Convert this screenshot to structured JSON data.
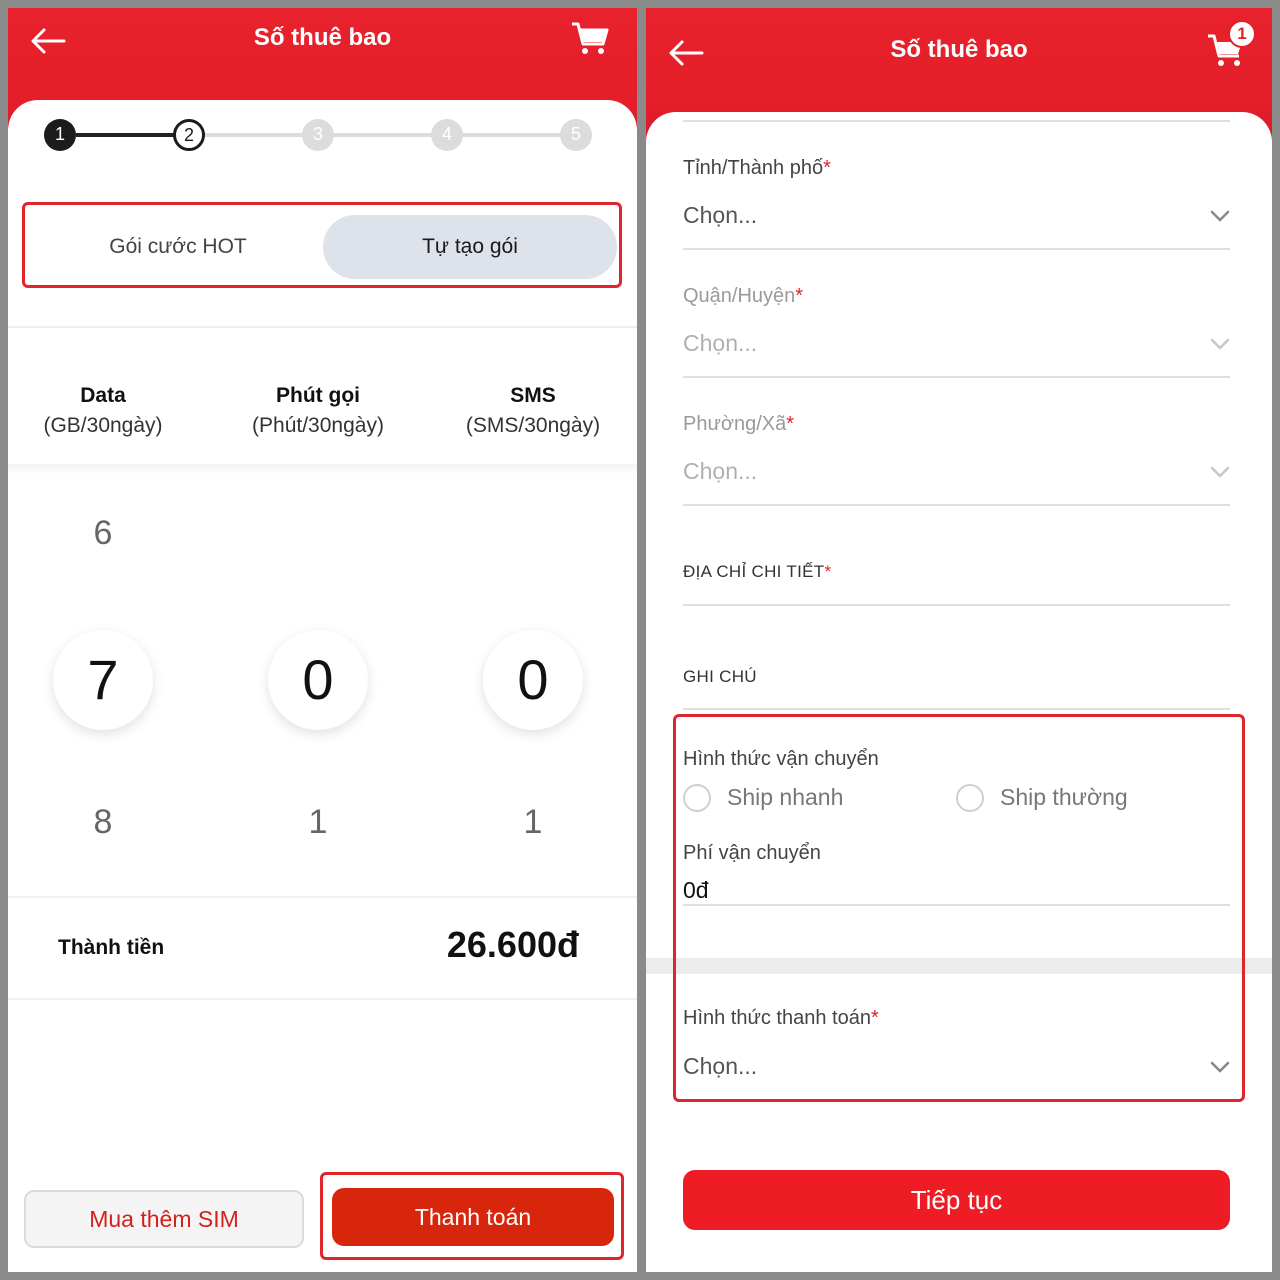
{
  "left": {
    "header": {
      "title": "Số thuê bao"
    },
    "stepper": {
      "steps": [
        "1",
        "2",
        "3",
        "4",
        "5"
      ]
    },
    "tabs": {
      "hot": "Gói cước HOT",
      "custom": "Tự tạo gói"
    },
    "columns": [
      {
        "title": "Data",
        "unit": "(GB/30ngày)"
      },
      {
        "title": "Phút gọi",
        "unit": "(Phút/30ngày)"
      },
      {
        "title": "SMS",
        "unit": "(SMS/30ngày)"
      }
    ],
    "wheels": {
      "data": {
        "above": "6",
        "selected": "7",
        "below": "8"
      },
      "minutes": {
        "above": "",
        "selected": "0",
        "below": "1"
      },
      "sms": {
        "above": "",
        "selected": "0",
        "below": "1"
      }
    },
    "total": {
      "label": "Thành tiền",
      "value": "26.600đ"
    },
    "buttons": {
      "buy_more": "Mua thêm SIM",
      "pay": "Thanh toán"
    }
  },
  "right": {
    "header": {
      "title": "Số thuê bao",
      "cart_count": "1"
    },
    "form": {
      "province": {
        "label": "Tỉnh/Thành phố",
        "required": "*",
        "value": "Chọn..."
      },
      "district": {
        "label": "Quận/Huyện",
        "required": "*",
        "value": "Chọn..."
      },
      "ward": {
        "label": "Phường/Xã",
        "required": "*",
        "value": "Chọn..."
      },
      "address": {
        "label": "ĐỊA CHỈ CHI TIẾT",
        "required": "*"
      },
      "note": {
        "label": "GHI CHÚ"
      },
      "shipping": {
        "label": "Hình thức vận chuyển",
        "options": [
          "Ship nhanh",
          "Ship thường"
        ],
        "fee_label": "Phí vận chuyển",
        "fee_value": "0đ"
      },
      "payment": {
        "label": "Hình thức thanh toán",
        "required": "*",
        "value": "Chọn..."
      }
    },
    "buttons": {
      "continue": "Tiếp tục"
    }
  },
  "colors": {
    "brand_red": "#e41f2a",
    "pay_button": "#d8260d",
    "highlight_border": "#e0252b",
    "tab_selected_bg": "#dee2ea"
  },
  "icons": [
    "back-arrow-icon",
    "cart-icon",
    "chevron-down-icon"
  ]
}
